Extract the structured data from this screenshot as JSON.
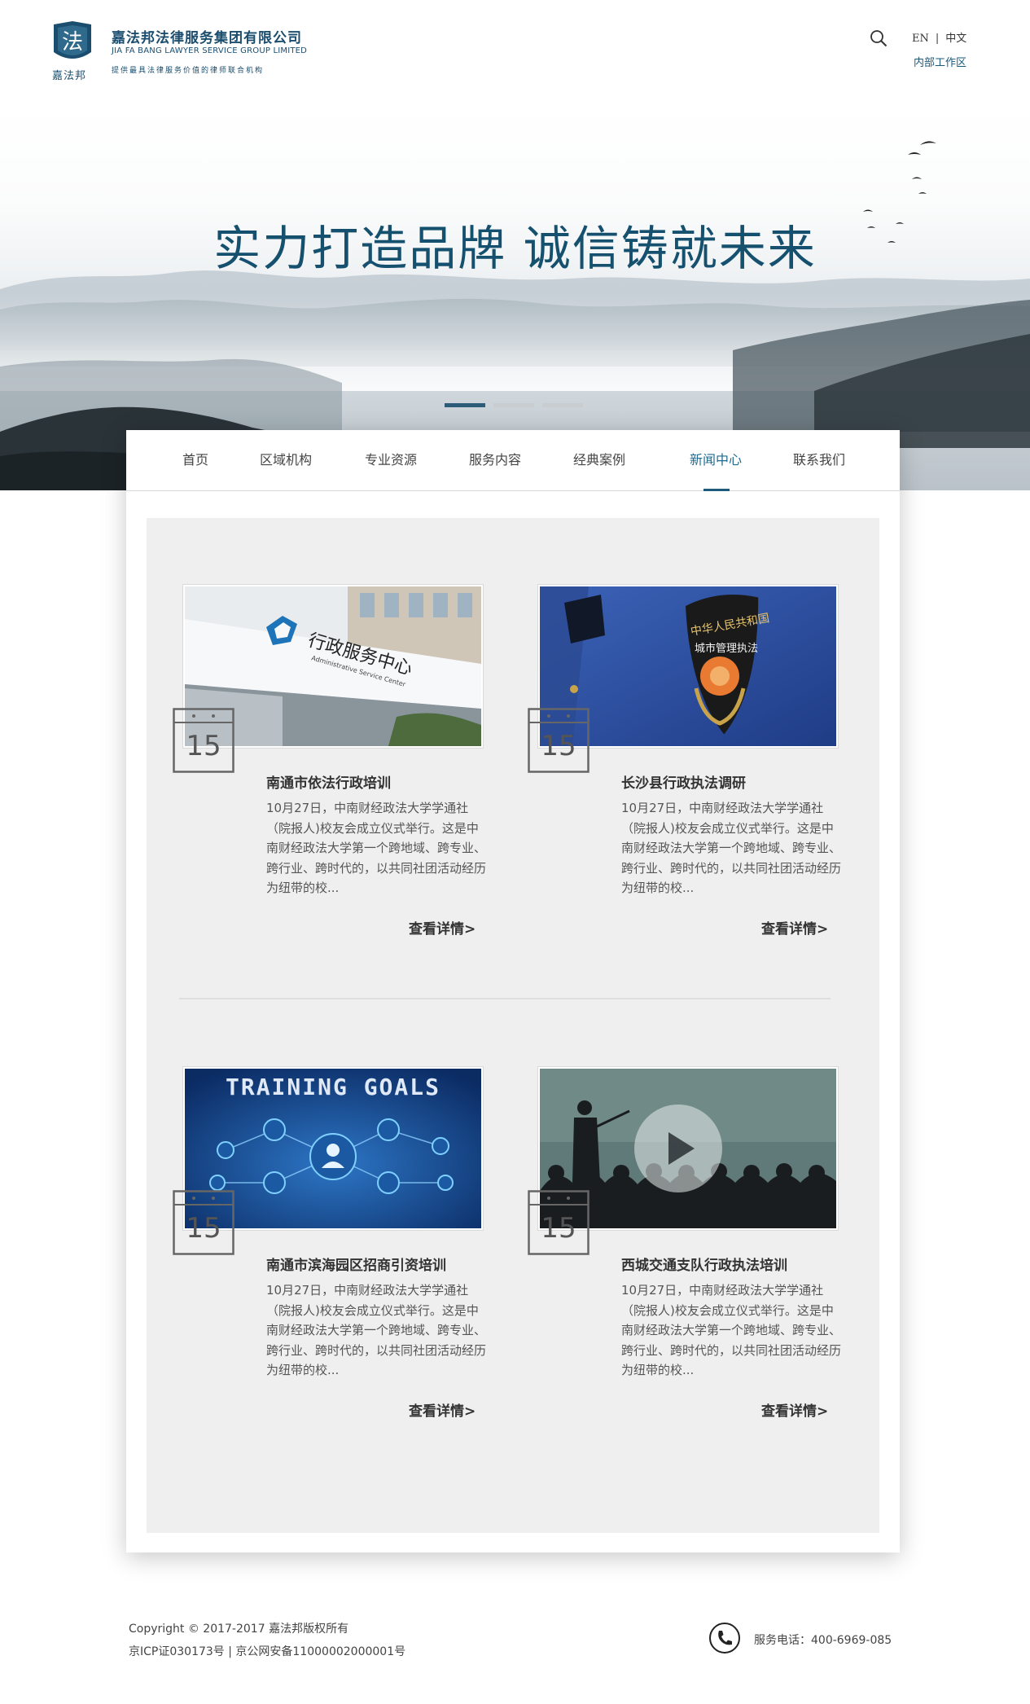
{
  "header": {
    "logo_mark_text": "嘉法邦",
    "company_cn": "嘉法邦法律服务集团有限公司",
    "company_en": "JIA FA BANG LAWYER SERVICE GROUP LIMITED",
    "tagline": "提供最具法律服务价值的律师联合机构",
    "lang_en": "EN",
    "lang_sep": "|",
    "lang_cn": "中文",
    "internal_link": "内部工作区"
  },
  "banner": {
    "title": "实力打造品牌  诚信铸就未来",
    "slides": 3,
    "active_slide": 1
  },
  "nav": {
    "items": [
      "首页",
      "区域机构",
      "专业资源",
      "服务内容",
      "经典案例",
      "新闻中心",
      "联系我们"
    ],
    "active": "新闻中心"
  },
  "news": [
    {
      "day": "15",
      "title": "南通市依法行政培训",
      "desc": "10月27日，中南财经政法大学学通社（院报人)校友会成立仪式举行。这是中南财经政法大学第一个跨地域、跨专业、跨行业、跨时代的，以共同社团活动经历为纽带的校...",
      "more": "查看详情>",
      "image_label": "行政服务中心",
      "image_label_en": "Administrative Service Center"
    },
    {
      "day": "15",
      "title": "长沙县行政执法调研",
      "desc": "10月27日，中南财经政法大学学通社（院报人)校友会成立仪式举行。这是中南财经政法大学第一个跨地域、跨专业、跨行业、跨时代的，以共同社团活动经历为纽带的校...",
      "more": "查看详情>",
      "image_label": "中华人民共和国",
      "image_label_2": "城市管理执法"
    },
    {
      "day": "15",
      "title": "南通市滨海园区招商引资培训",
      "desc": "10月27日，中南财经政法大学学通社（院报人)校友会成立仪式举行。这是中南财经政法大学第一个跨地域、跨专业、跨行业、跨时代的，以共同社团活动经历为纽带的校...",
      "more": "查看详情>",
      "image_label": "TRAINING GOALS"
    },
    {
      "day": "15",
      "title": "西城交通支队行政执法培训",
      "desc": "10月27日，中南财经政法大学学通社（院报人)校友会成立仪式举行。这是中南财经政法大学第一个跨地域、跨专业、跨行业、跨时代的，以共同社团活动经历为纽带的校...",
      "more": "查看详情>"
    }
  ],
  "footer": {
    "copyright": "Copyright © 2017-2017 嘉法邦版权所有",
    "icp": "京ICP证030173号 | 京公网安备11000002000001号",
    "phone": "服务电话：400-6969-085"
  },
  "colors": {
    "brand": "#1a4d6e",
    "accent": "#1e6b8f",
    "content_bg": "#efefef"
  },
  "icons": [
    "logo-icon",
    "search-icon",
    "calendar-icon",
    "play-icon",
    "phone-icon"
  ]
}
